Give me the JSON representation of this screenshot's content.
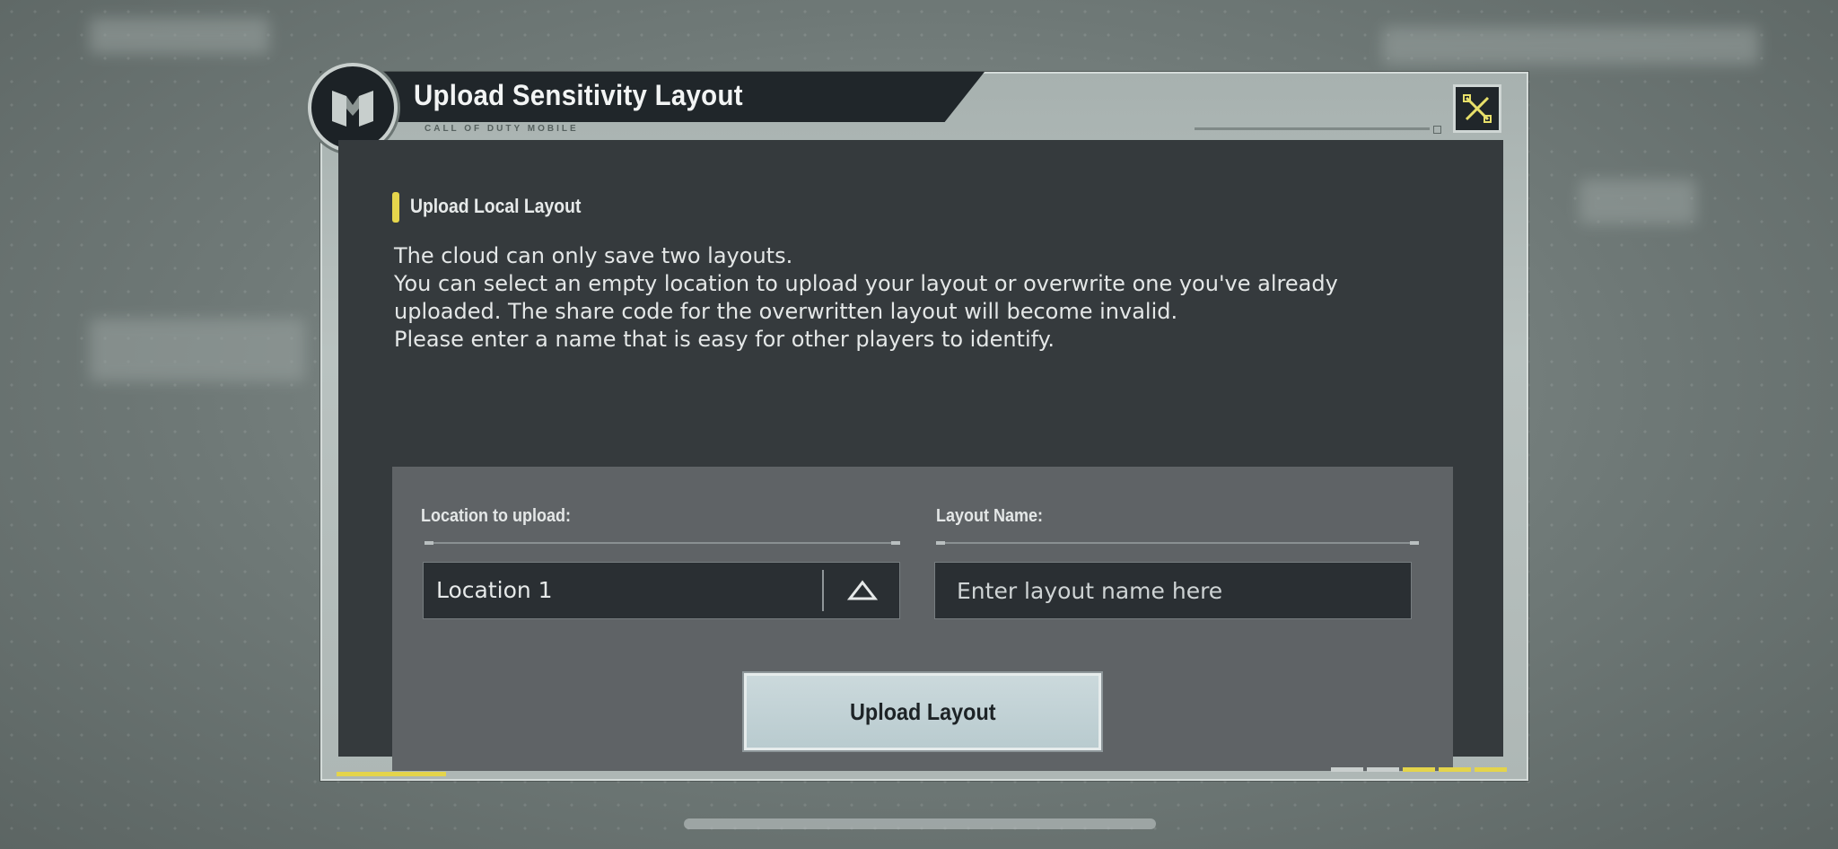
{
  "dialog": {
    "title": "Upload Sensitivity Layout",
    "subtitle": "CALL OF DUTY MOBILE",
    "close_icon": "close-x-icon",
    "logo_icon": "cod-m-logo-icon"
  },
  "section": {
    "title": "Upload Local Layout",
    "description_lines": [
      "The cloud can only save two layouts.",
      "You can select an empty location to upload your layout or overwrite one you've already",
      "uploaded. The share code for the overwritten layout will become invalid.",
      "Please enter a name that is easy for other players to identify."
    ]
  },
  "form": {
    "location_label": "Location to upload:",
    "location_value": "Location 1",
    "location_arrow_icon": "triangle-up-icon",
    "name_label": "Layout Name:",
    "name_placeholder": "Enter layout name here",
    "name_value": "",
    "submit_label": "Upload Layout"
  },
  "colors": {
    "accent_yellow": "#e6d64c",
    "panel_dark": "#353a3d",
    "field_bg": "#2a2f33",
    "button_bg": "#c4d4d7"
  }
}
